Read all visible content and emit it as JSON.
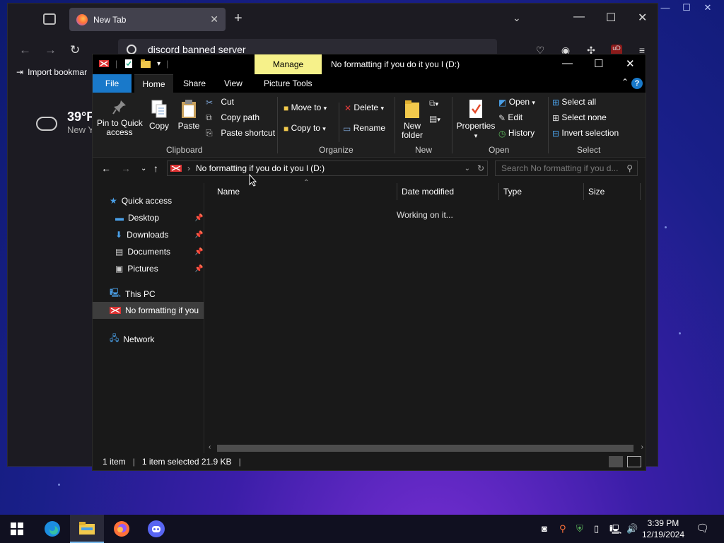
{
  "firefox": {
    "tab_title": "New Tab",
    "url_text": "discord banned server",
    "bookmark_label": "Import bookmar",
    "weather_temp": "39°F",
    "weather_location": "New Y"
  },
  "explorer": {
    "context_tab": "Manage",
    "window_title": "No formatting if you do it you l (D:)",
    "tabs": {
      "file": "File",
      "home": "Home",
      "share": "Share",
      "view": "View",
      "picture_tools": "Picture Tools"
    },
    "ribbon": {
      "pin_quick_access_line1": "Pin to Quick",
      "pin_quick_access_line2": "access",
      "copy": "Copy",
      "paste": "Paste",
      "cut": "Cut",
      "copy_path": "Copy path",
      "paste_shortcut": "Paste shortcut",
      "move_to": "Move to",
      "copy_to": "Copy to",
      "delete": "Delete",
      "rename": "Rename",
      "new_folder_line1": "New",
      "new_folder_line2": "folder",
      "properties": "Properties",
      "open": "Open",
      "edit": "Edit",
      "history": "History",
      "select_all": "Select all",
      "select_none": "Select none",
      "invert_selection": "Invert selection",
      "groups": {
        "clipboard": "Clipboard",
        "organize": "Organize",
        "new": "New",
        "open": "Open",
        "select": "Select"
      }
    },
    "address": "No formatting if you do it you l (D:)",
    "search_placeholder": "Search No formatting if you d...",
    "nav": {
      "quick_access": "Quick access",
      "desktop": "Desktop",
      "downloads": "Downloads",
      "documents": "Documents",
      "pictures": "Pictures",
      "this_pc": "This PC",
      "drive": "No formatting if you",
      "network": "Network"
    },
    "columns": {
      "name": "Name",
      "date_modified": "Date modified",
      "type": "Type",
      "size": "Size"
    },
    "working_text": "Working on it...",
    "status": {
      "count": "1 item",
      "selected": "1 item selected  21.9 KB"
    }
  },
  "taskbar": {
    "time": "3:39 PM",
    "date": "12/19/2024"
  }
}
